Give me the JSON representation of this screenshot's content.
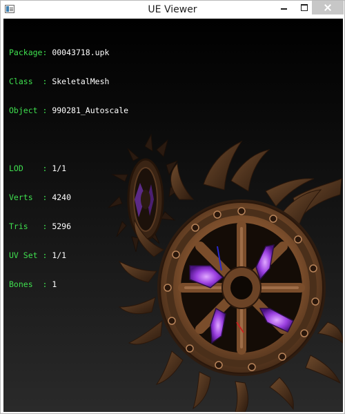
{
  "window": {
    "title": "UE Viewer",
    "app_icon": "window-app-icon",
    "controls": {
      "minimize": "minimize-icon",
      "maximize": "maximize-icon",
      "close": "close-icon"
    }
  },
  "info": {
    "package_label": "Package:",
    "package_value": "00043718.upk",
    "class_label": "Class  :",
    "class_value": "SkeletalMesh",
    "object_label": "Object :",
    "object_value": "990281_Autoscale",
    "lod_label": "LOD    :",
    "lod_value": "1/1",
    "verts_label": "Verts  :",
    "verts_value": "4240",
    "tris_label": "Tris   :",
    "tris_value": "5296",
    "uvset_label": "UV Set :",
    "uvset_value": "1/1",
    "bones_label": "Bones  :",
    "bones_value": "1"
  },
  "colors": {
    "label": "#3fe04f",
    "value": "#ffffff",
    "viewport_top": "#000000",
    "viewport_bottom": "#2a2a2a",
    "mesh_bronze": "#8a5a32",
    "mesh_dark": "#3a2414",
    "glow_purple": "#9b40e0"
  }
}
